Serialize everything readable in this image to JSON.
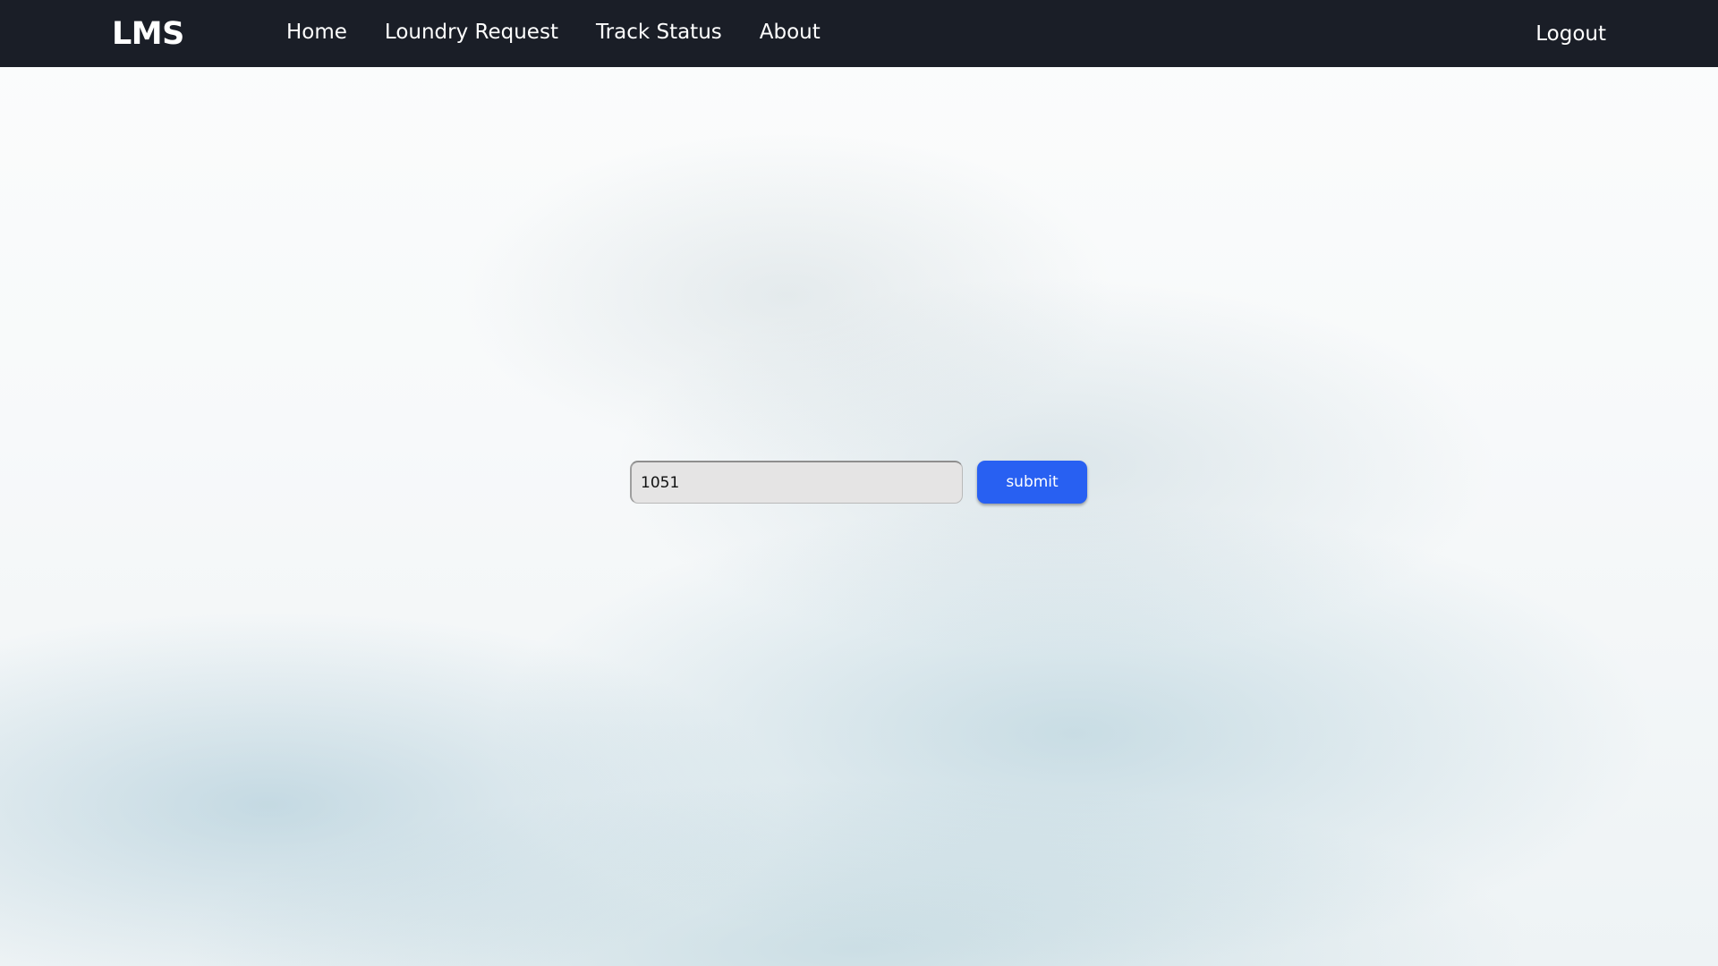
{
  "navbar": {
    "brand": "LMS",
    "links": [
      {
        "label": "Home"
      },
      {
        "label": "Loundry Request"
      },
      {
        "label": "Track Status"
      },
      {
        "label": "About"
      }
    ],
    "logout_label": "Logout"
  },
  "tracker": {
    "input_value": "1051",
    "submit_label": "submit"
  },
  "colors": {
    "navbar_bg": "#1a1e27",
    "accent": "#2860f2",
    "input_bg": "#e5e4e4"
  }
}
